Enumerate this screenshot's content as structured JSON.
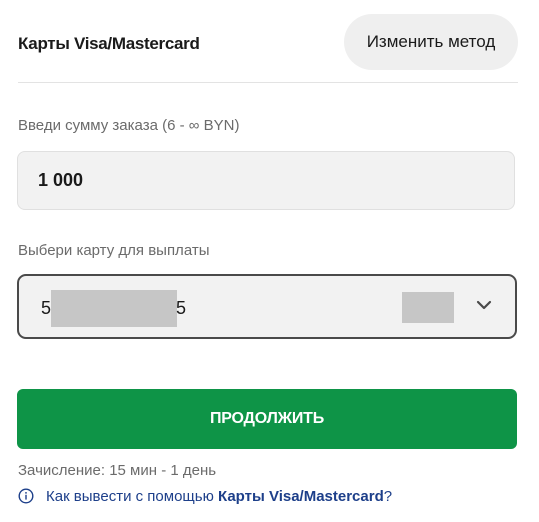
{
  "header": {
    "method_title": "Карты Visa/Mastercard",
    "change_method_label": "Изменить метод"
  },
  "amount": {
    "label": "Введи сумму заказа (6 - ∞ BYN)",
    "value": "1 000"
  },
  "card": {
    "label": "Выбери карту для выплаты",
    "number_prefix": "5",
    "number_suffix": "5"
  },
  "actions": {
    "continue_label": "ПРОДОЛЖИТЬ"
  },
  "footer": {
    "credit_info": "Зачисление: 15 мин - 1 день",
    "help_prefix": "Как вывести с помощью ",
    "help_link": "Карты Visa/Mastercard",
    "help_suffix": "?"
  },
  "icons": {
    "dropdown": "chevron-down-icon",
    "help": "info-icon"
  },
  "colors": {
    "accent_green": "#0e9447",
    "link_blue": "#1d3f8a",
    "muted_text": "#6b6b6b",
    "field_bg": "#f2f2f2"
  }
}
